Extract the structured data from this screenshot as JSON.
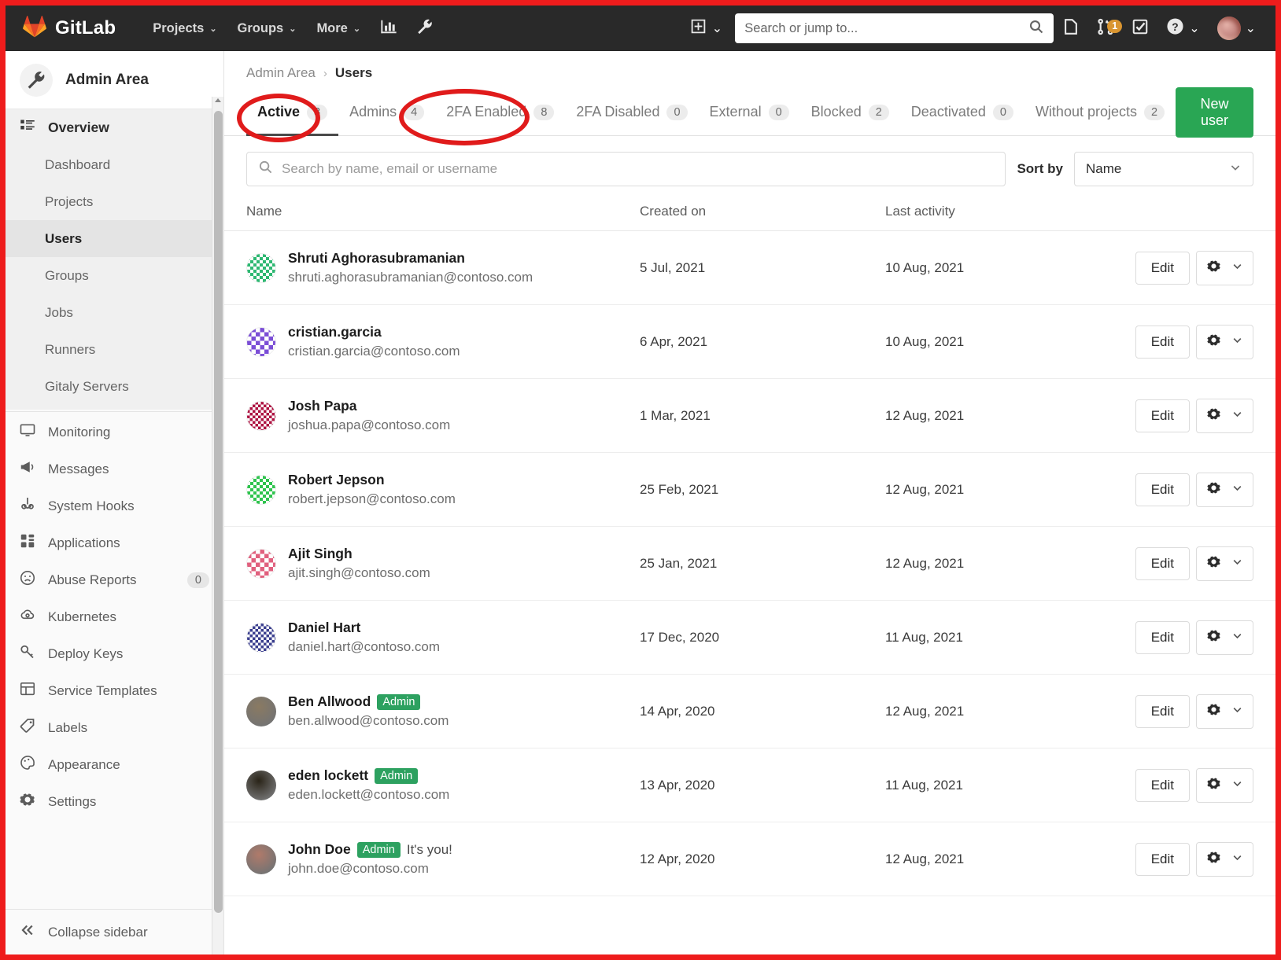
{
  "topnav": {
    "brand": "GitLab",
    "brand_logo_icon": "gitlab-tanuki-logo",
    "items": [
      {
        "label": "Projects",
        "chevron": "⌄"
      },
      {
        "label": "Groups",
        "chevron": "⌄"
      },
      {
        "label": "More",
        "chevron": "⌄"
      }
    ],
    "analytics_icon": "chart-bar-icon",
    "admin_icon": "wrench-icon",
    "plus_icon": "plus-square-icon",
    "plus_chevron": "⌄",
    "search_placeholder": "Search or jump to...",
    "search_icon": "magnifier-icon",
    "issues_icon": "issues-icon",
    "merge_requests_icon": "merge-request-icon",
    "merge_requests_badge": "1",
    "todos_icon": "todo-check-icon",
    "help_icon": "question-circle-icon",
    "help_chevron": "⌄",
    "avatar_icon": "user-avatar",
    "avatar_chevron": "⌄"
  },
  "sidebar": {
    "header_title": "Admin Area",
    "header_icon": "wrench-icon",
    "overview": {
      "label": "Overview",
      "icon": "overview-list-icon"
    },
    "sub_items": [
      {
        "label": "Dashboard",
        "active": false
      },
      {
        "label": "Projects",
        "active": false
      },
      {
        "label": "Users",
        "active": true
      },
      {
        "label": "Groups",
        "active": false
      },
      {
        "label": "Jobs",
        "active": false
      },
      {
        "label": "Runners",
        "active": false
      },
      {
        "label": "Gitaly Servers",
        "active": false
      }
    ],
    "flat_items": [
      {
        "label": "Monitoring",
        "icon": "monitor-icon",
        "count": null
      },
      {
        "label": "Messages",
        "icon": "megaphone-icon",
        "count": null
      },
      {
        "label": "System Hooks",
        "icon": "hook-icon",
        "count": null
      },
      {
        "label": "Applications",
        "icon": "apps-grid-icon",
        "count": null
      },
      {
        "label": "Abuse Reports",
        "icon": "frown-face-icon",
        "count": "0"
      },
      {
        "label": "Kubernetes",
        "icon": "kubernetes-cloud-icon",
        "count": null
      },
      {
        "label": "Deploy Keys",
        "icon": "key-icon",
        "count": null
      },
      {
        "label": "Service Templates",
        "icon": "template-layout-icon",
        "count": null
      },
      {
        "label": "Labels",
        "icon": "label-tag-icon",
        "count": null
      },
      {
        "label": "Appearance",
        "icon": "palette-icon",
        "count": null
      },
      {
        "label": "Settings",
        "icon": "gear-icon",
        "count": null
      }
    ],
    "collapse_label": "Collapse sidebar",
    "collapse_icon": "double-chevron-left-icon"
  },
  "breadcrumb": {
    "root": "Admin Area",
    "separator": "›",
    "current": "Users"
  },
  "tabs": [
    {
      "label": "Active",
      "count": "8",
      "active": true
    },
    {
      "label": "Admins",
      "count": "4",
      "active": false
    },
    {
      "label": "2FA Enabled",
      "count": "8",
      "active": false
    },
    {
      "label": "2FA Disabled",
      "count": "0",
      "active": false
    },
    {
      "label": "External",
      "count": "0",
      "active": false
    },
    {
      "label": "Blocked",
      "count": "2",
      "active": false
    },
    {
      "label": "Deactivated",
      "count": "0",
      "active": false
    },
    {
      "label": "Without projects",
      "count": "2",
      "active": false
    }
  ],
  "new_user_button": "New user",
  "search": {
    "placeholder": "Search by name, email or username",
    "value": "",
    "icon": "magnifier-icon"
  },
  "sort": {
    "label": "Sort by",
    "selected": "Name",
    "chevron_icon": "chevron-down-icon"
  },
  "table": {
    "headers": {
      "name": "Name",
      "created": "Created on",
      "activity": "Last activity"
    },
    "row_actions": {
      "edit": "Edit",
      "gear_icon": "gear-icon",
      "chevron_icon": "chevron-down-icon"
    },
    "rows": [
      {
        "name": "Shruti Aghorasubramanian",
        "email": "shruti.aghorasubramanian@contoso.com",
        "badge": null,
        "you": null,
        "created": "5 Jul, 2021",
        "activity": "10 Aug, 2021",
        "avatar_type": "identicon",
        "avatar_color": "#2eb872"
      },
      {
        "name": "cristian.garcia",
        "email": "cristian.garcia@contoso.com",
        "badge": null,
        "you": null,
        "created": "6 Apr, 2021",
        "activity": "10 Aug, 2021",
        "avatar_type": "identicon",
        "avatar_color": "#7b4ed6"
      },
      {
        "name": "Josh Papa",
        "email": "joshua.papa@contoso.com",
        "badge": null,
        "you": null,
        "created": "1 Mar, 2021",
        "activity": "12 Aug, 2021",
        "avatar_type": "identicon",
        "avatar_color": "#ad1140"
      },
      {
        "name": "Robert Jepson",
        "email": "robert.jepson@contoso.com",
        "badge": null,
        "you": null,
        "created": "25 Feb, 2021",
        "activity": "12 Aug, 2021",
        "avatar_type": "identicon",
        "avatar_color": "#2fc44e"
      },
      {
        "name": "Ajit Singh",
        "email": "ajit.singh@contoso.com",
        "badge": null,
        "you": null,
        "created": "25 Jan, 2021",
        "activity": "12 Aug, 2021",
        "avatar_type": "identicon",
        "avatar_color": "#e0607e"
      },
      {
        "name": "Daniel Hart",
        "email": "daniel.hart@contoso.com",
        "badge": null,
        "you": null,
        "created": "17 Dec, 2020",
        "activity": "11 Aug, 2021",
        "avatar_type": "identicon",
        "avatar_color": "#3b3f8f"
      },
      {
        "name": "Ben Allwood",
        "email": "ben.allwood@contoso.com",
        "badge": "Admin",
        "you": null,
        "created": "14 Apr, 2020",
        "activity": "12 Aug, 2021",
        "avatar_type": "photo",
        "avatar_color": "#8a7a62"
      },
      {
        "name": "eden lockett",
        "email": "eden.lockett@contoso.com",
        "badge": "Admin",
        "you": null,
        "created": "13 Apr, 2020",
        "activity": "11 Aug, 2021",
        "avatar_type": "photo",
        "avatar_color": "#2a2418"
      },
      {
        "name": "John Doe",
        "email": "john.doe@contoso.com",
        "badge": "Admin",
        "you": "It's you!",
        "created": "12 Apr, 2020",
        "activity": "12 Aug, 2021",
        "avatar_type": "photo",
        "avatar_color": "#b07a6a"
      }
    ]
  },
  "annotations": {
    "ellipse_color": "#e01b1b",
    "ellipses": [
      {
        "target": "tab-active"
      },
      {
        "target": "tab-2fa-enabled"
      }
    ],
    "frame": {
      "color": "#ee1c1c"
    }
  }
}
